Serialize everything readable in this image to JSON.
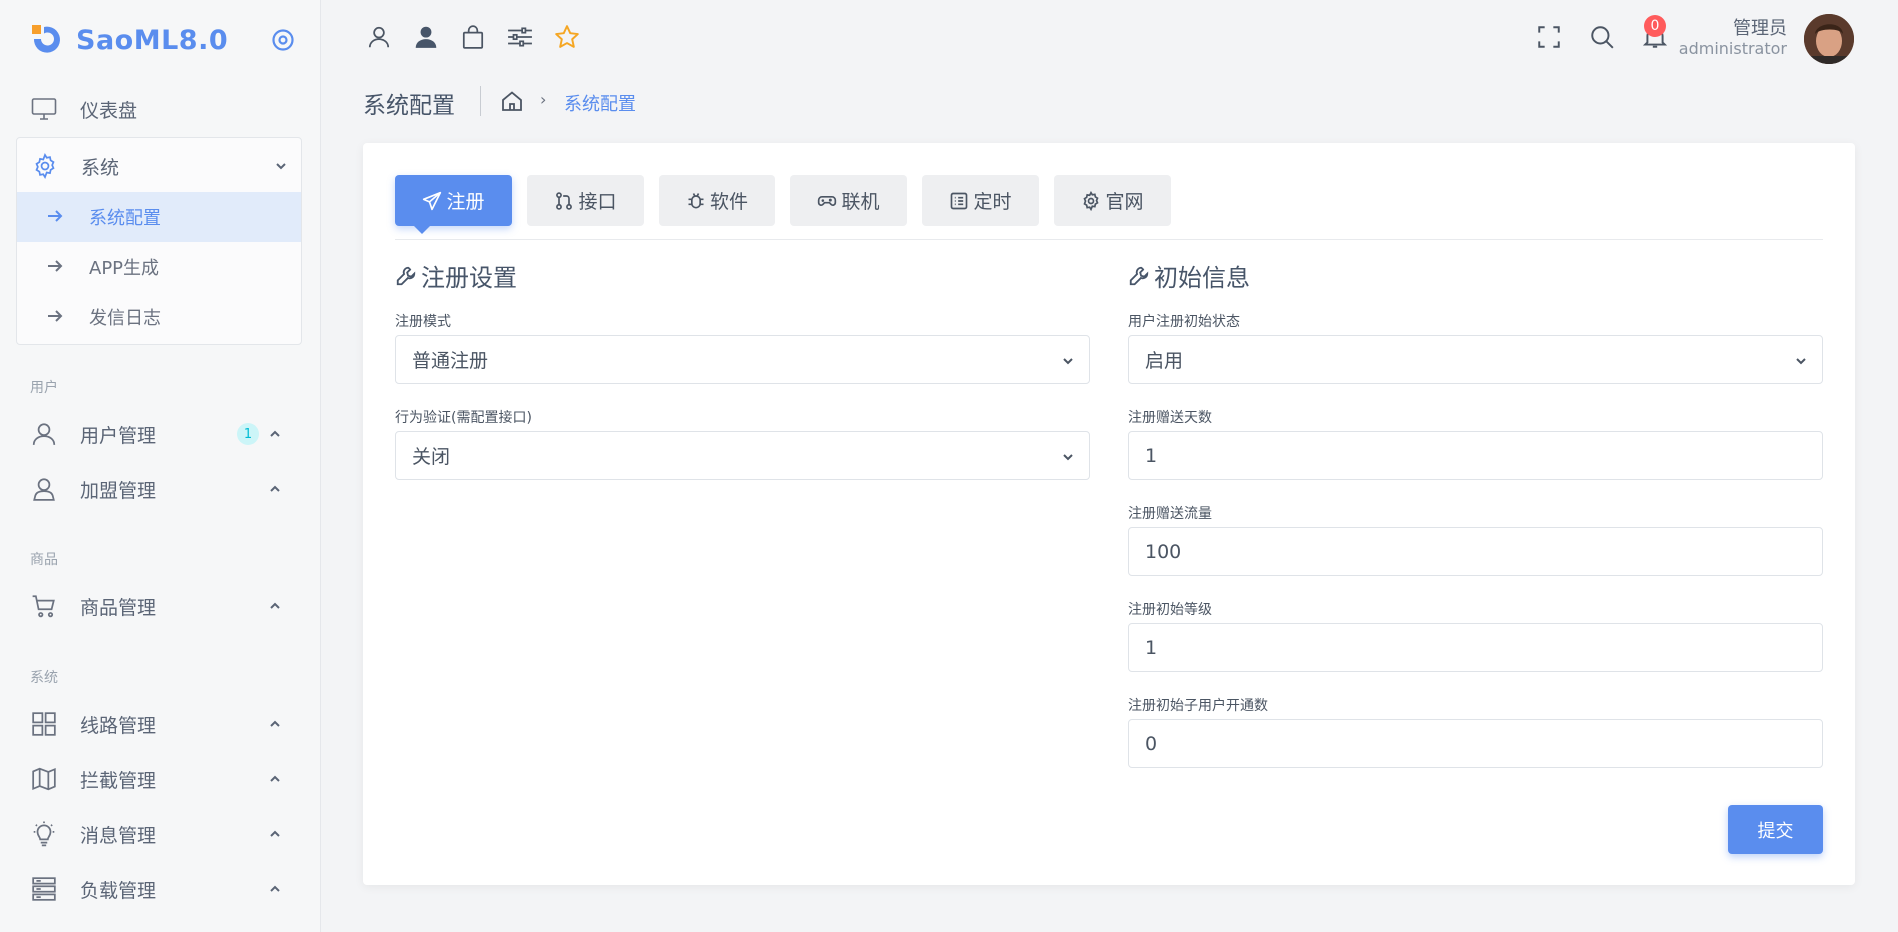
{
  "app": {
    "brand": "SaoML8.0"
  },
  "sidebar": {
    "dashboard": "仪表盘",
    "system_group": {
      "label": "系统",
      "items": [
        {
          "label": "系统配置"
        },
        {
          "label": "APP生成"
        },
        {
          "label": "发信日志"
        }
      ]
    },
    "sections": {
      "user": "用户",
      "product": "商品",
      "system": "系统"
    },
    "user_mgmt": "用户管理",
    "user_mgmt_badge": "1",
    "franchise_mgmt": "加盟管理",
    "product_mgmt": "商品管理",
    "route_mgmt": "线路管理",
    "intercept_mgmt": "拦截管理",
    "message_mgmt": "消息管理",
    "load_mgmt": "负载管理"
  },
  "header": {
    "notification_count": "0",
    "user_name": "管理员",
    "user_role": "administrator"
  },
  "page": {
    "title": "系统配置",
    "breadcrumb_separator": "›",
    "breadcrumb_current": "系统配置"
  },
  "tabs": [
    {
      "label": "注册"
    },
    {
      "label": "接口"
    },
    {
      "label": "软件"
    },
    {
      "label": "联机"
    },
    {
      "label": "定时"
    },
    {
      "label": "官网"
    }
  ],
  "register_settings": {
    "title": "注册设置",
    "mode_label": "注册模式",
    "mode_value": "普通注册",
    "verify_label": "行为验证(需配置接口)",
    "verify_value": "关闭"
  },
  "initial_info": {
    "title": "初始信息",
    "status_label": "用户注册初始状态",
    "status_value": "启用",
    "days_label": "注册赠送天数",
    "days_value": "1",
    "traffic_label": "注册赠送流量",
    "traffic_value": "100",
    "level_label": "注册初始等级",
    "level_value": "1",
    "subusers_label": "注册初始子用户开通数",
    "subusers_value": "0"
  },
  "submit_label": "提交",
  "colors": {
    "accent": "#5a8dee",
    "badge_red": "#ff5b5c",
    "star": "#f5a623"
  }
}
